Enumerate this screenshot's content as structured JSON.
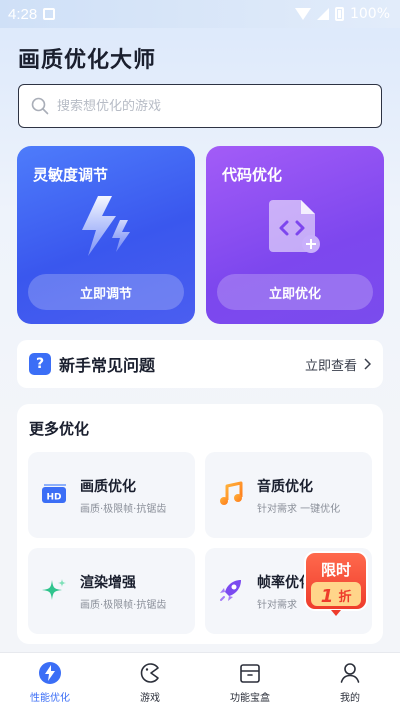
{
  "status_bar": {
    "time": "4:28",
    "battery_pct": "100%"
  },
  "header": {
    "title": "画质优化大师"
  },
  "search": {
    "placeholder": "搜索想优化的游戏"
  },
  "cards": [
    {
      "title": "灵敏度调节",
      "button": "立即调节",
      "icon": "lightning-icon"
    },
    {
      "title": "代码优化",
      "button": "立即优化",
      "icon": "code-file-icon"
    }
  ],
  "faq": {
    "icon_text": "?",
    "title": "新手常见问题",
    "link": "立即查看"
  },
  "more": {
    "title": "更多优化",
    "items": [
      {
        "title": "画质优化",
        "sub": "画质·极限帧·抗锯齿",
        "icon": "hd-icon"
      },
      {
        "title": "音质优化",
        "sub": "针对需求 一键优化",
        "icon": "music-note-icon"
      },
      {
        "title": "渲染增强",
        "sub": "画质·极限帧·抗锯齿",
        "icon": "sparkle-icon"
      },
      {
        "title": "帧率优化",
        "sub": "针对需求",
        "icon": "rocket-icon"
      }
    ]
  },
  "promo": {
    "line1": "限时",
    "line2_num": "1",
    "line2_unit": "折"
  },
  "nav": [
    {
      "label": "性能优化",
      "active": true,
      "icon": "performance-icon"
    },
    {
      "label": "游戏",
      "active": false,
      "icon": "game-icon"
    },
    {
      "label": "功能宝盒",
      "active": false,
      "icon": "toolbox-icon"
    },
    {
      "label": "我的",
      "active": false,
      "icon": "profile-icon"
    }
  ],
  "colors": {
    "accent": "#3b6ef6",
    "card_blue": "#3a57ee",
    "card_purple": "#7d47ee",
    "promo_red": "#f0513c"
  }
}
